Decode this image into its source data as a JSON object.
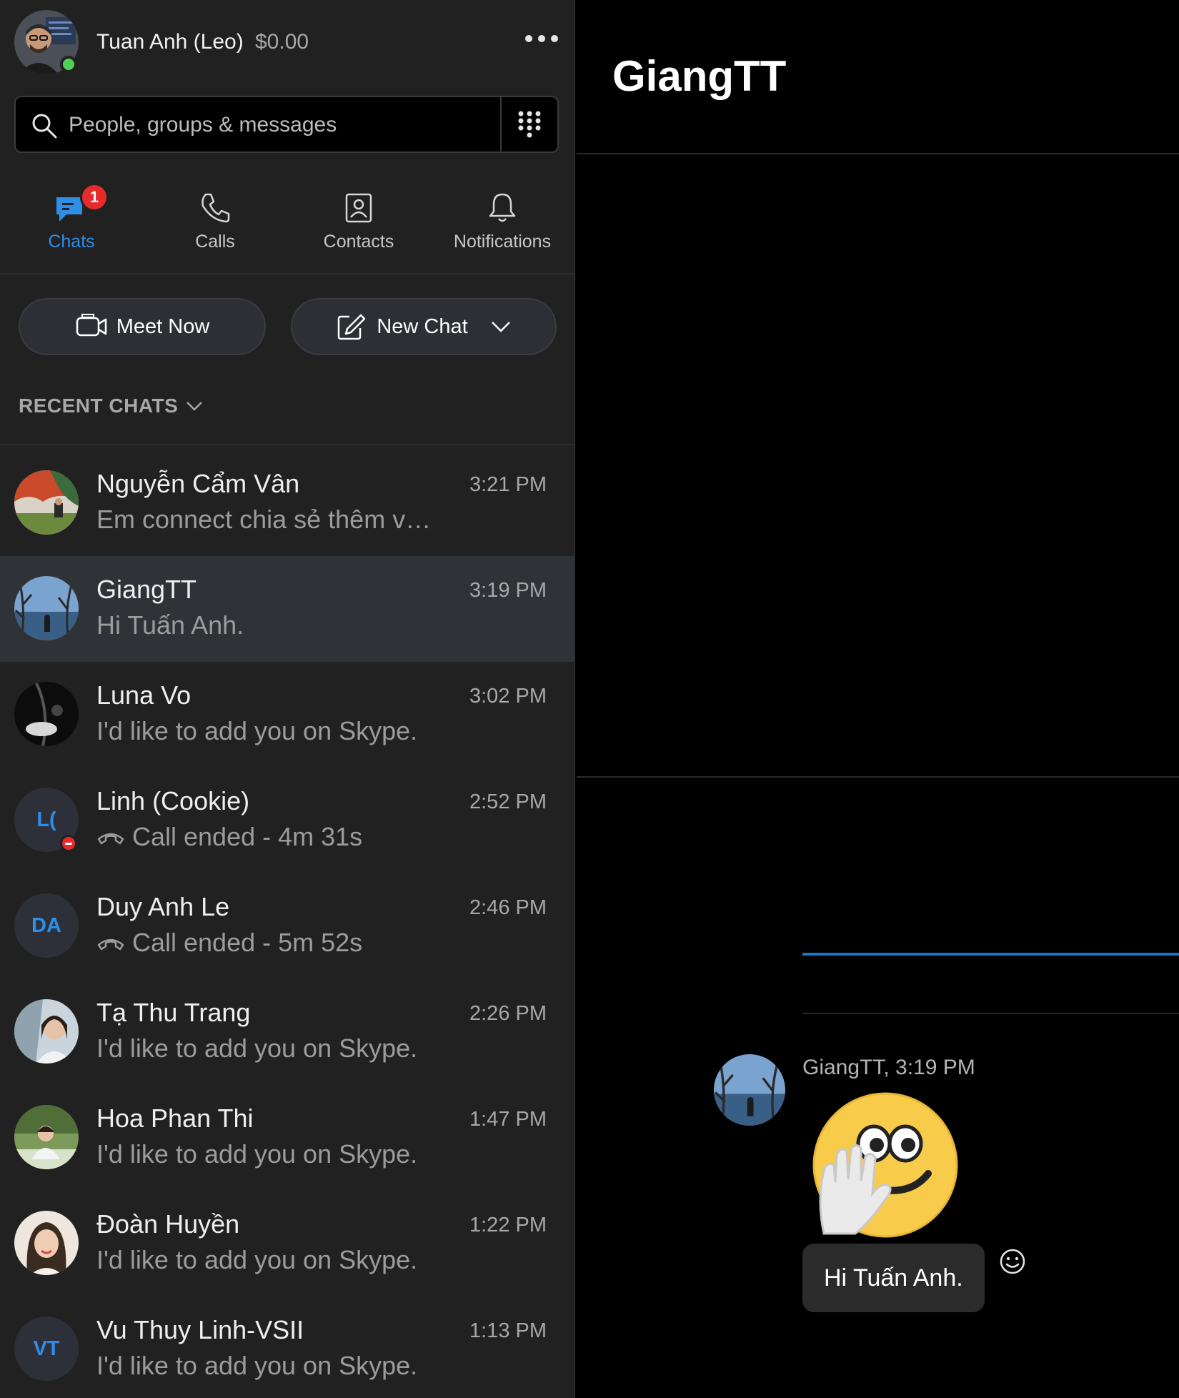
{
  "profile": {
    "name": "Tuan Anh (Leo)",
    "balance": "$0.00",
    "presence": "online"
  },
  "search": {
    "placeholder": "People, groups & messages"
  },
  "tabs": [
    {
      "label": "Chats",
      "icon": "chat-icon",
      "active": true,
      "badge": "1"
    },
    {
      "label": "Calls",
      "icon": "phone-icon"
    },
    {
      "label": "Contacts",
      "icon": "contacts-icon"
    },
    {
      "label": "Notifications",
      "icon": "bell-icon"
    }
  ],
  "actions": {
    "meet_now": "Meet Now",
    "new_chat": "New Chat"
  },
  "recent_header": "RECENT CHATS",
  "chats": [
    {
      "name": "Nguyễn Cẩm Vân",
      "time": "3:21 PM",
      "preview": "Em connect chia sẻ thêm v…"
    },
    {
      "name": "GiangTT",
      "time": "3:19 PM",
      "preview": "Hi Tuấn Anh.",
      "selected": true
    },
    {
      "name": "Luna Vo",
      "time": "3:02 PM",
      "preview": "I'd like to add you on Skype."
    },
    {
      "name": "Linh (Cookie)",
      "time": "2:52 PM",
      "preview": "Call ended - 4m 31s",
      "initials": "L(",
      "status": "do-not-disturb"
    },
    {
      "name": "Duy Anh Le",
      "time": "2:46 PM",
      "preview": "Call ended - 5m 52s",
      "initials": "DA"
    },
    {
      "name": "Tạ Thu Trang",
      "time": "2:26 PM",
      "preview": "I'd like to add you on Skype."
    },
    {
      "name": "Hoa Phan Thi",
      "time": "1:47 PM",
      "preview": "I'd like to add you on Skype."
    },
    {
      "name": "Đoàn Huyền",
      "time": "1:22 PM",
      "preview": "I'd like to add you on Skype."
    },
    {
      "name": "Vu Thuy Linh-VSII",
      "time": "1:13 PM",
      "preview": "I'd like to add you on Skype.",
      "initials": "VT"
    }
  ],
  "conversation": {
    "title": "GiangTT",
    "message": {
      "meta": "GiangTT, 3:19 PM",
      "sticker": "wave-emoji-sticker",
      "text": "Hi Tuấn Anh."
    }
  },
  "colors": {
    "accent": "#2e8ee8",
    "sidebar_bg": "#212121",
    "selected_bg": "#2f3237",
    "badge_red": "#e62b2b",
    "online_green": "#4fd054"
  }
}
